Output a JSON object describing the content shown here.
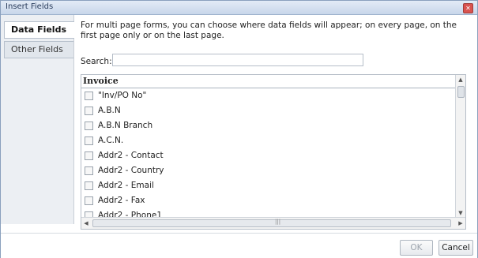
{
  "window": {
    "title": "Insert Fields",
    "close_glyph": "✕"
  },
  "tabs": [
    {
      "label": "Data Fields",
      "active": true
    },
    {
      "label": "Other Fields",
      "active": false
    }
  ],
  "description": "For multi page forms, you can choose where data fields will appear; on every page, on the first page only or on the last page.",
  "search": {
    "label": "Search:",
    "value": "",
    "placeholder": ""
  },
  "list": {
    "group": "Invoice",
    "items": [
      {
        "label": "\"Inv/PO No\"",
        "checked": false
      },
      {
        "label": "A.B.N",
        "checked": false
      },
      {
        "label": "A.B.N Branch",
        "checked": false
      },
      {
        "label": "A.C.N.",
        "checked": false
      },
      {
        "label": "Addr2 - Contact",
        "checked": false
      },
      {
        "label": "Addr2 - Country",
        "checked": false
      },
      {
        "label": "Addr2 - Email",
        "checked": false
      },
      {
        "label": "Addr2 - Fax",
        "checked": false
      },
      {
        "label": "Addr2 - Phone1",
        "checked": false
      }
    ]
  },
  "scroll": {
    "up": "▲",
    "down": "▼",
    "left": "◀",
    "right": "▶",
    "grip": "|||"
  },
  "buttons": {
    "ok_label": "OK",
    "ok_enabled": false,
    "cancel_label": "Cancel"
  },
  "colors": {
    "titlebar": "#c8d6ea",
    "accent_border": "#8aa0bd",
    "close_button": "#d9534f"
  }
}
